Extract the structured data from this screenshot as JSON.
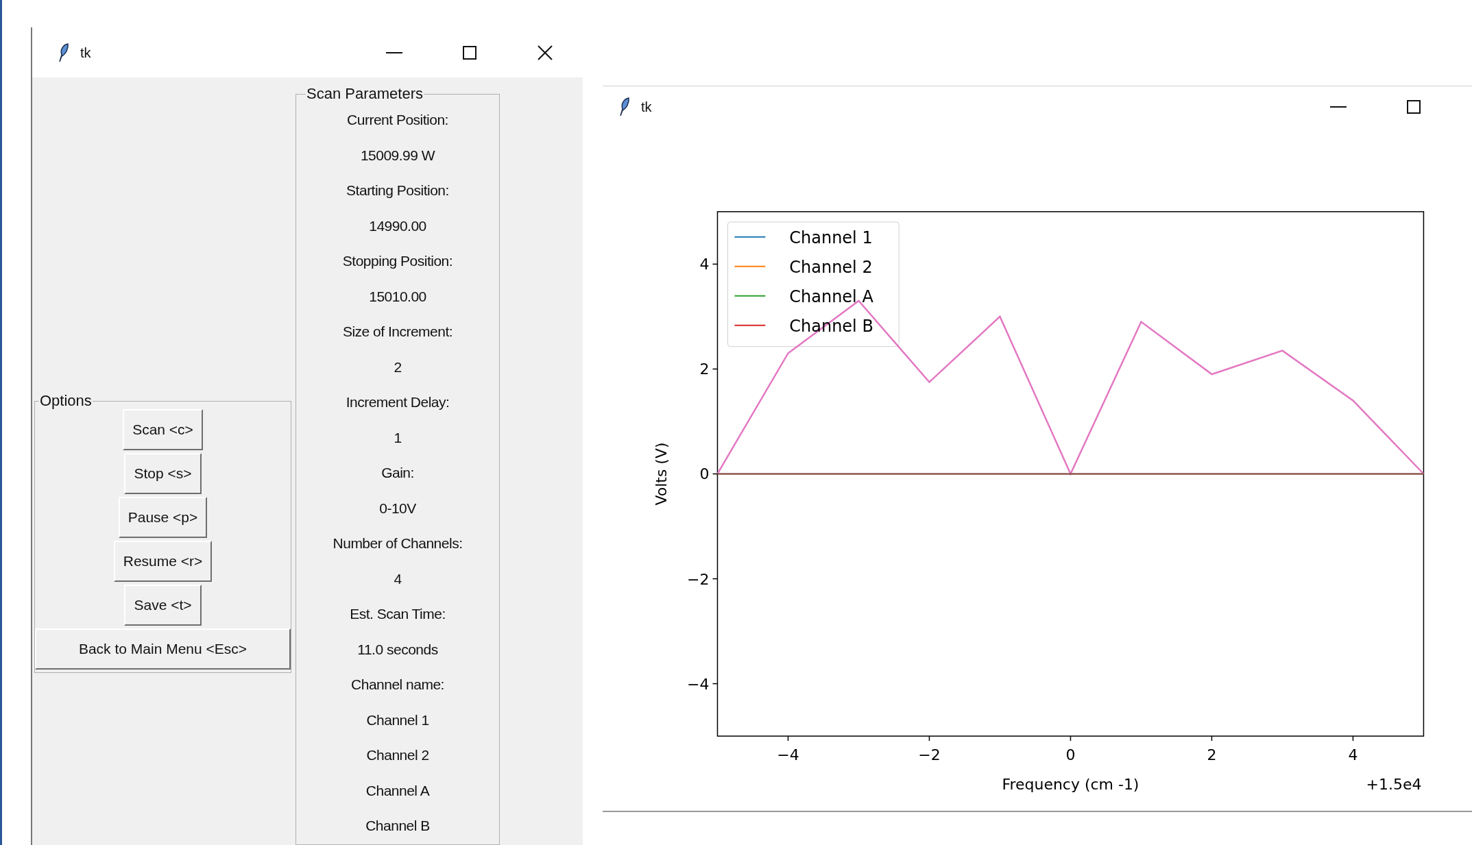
{
  "control_window": {
    "title": "tk",
    "options": {
      "title": "Options",
      "buttons": [
        {
          "label": "Scan <c>",
          "kind": "compact"
        },
        {
          "label": "Stop <s>",
          "kind": "compact"
        },
        {
          "label": "Pause <p>",
          "kind": "compact"
        },
        {
          "label": "Resume <r>",
          "kind": "compact"
        },
        {
          "label": "Save <t>",
          "kind": "compact"
        },
        {
          "label": "Back to Main Menu <Esc>",
          "kind": "wide"
        }
      ]
    },
    "scan_parameters": {
      "title": "Scan Parameters",
      "fields": [
        {
          "label": "Current Position:",
          "value": "15009.99 W"
        },
        {
          "label": "Starting Position:",
          "value": "14990.00"
        },
        {
          "label": "Stopping Position:",
          "value": "15010.00"
        },
        {
          "label": "Size of Increment:",
          "value": "2"
        },
        {
          "label": "Increment Delay:",
          "value": "1"
        },
        {
          "label": "Gain:",
          "value": "0-10V"
        },
        {
          "label": "Number of Channels:",
          "value": "4"
        },
        {
          "label": "Est. Scan Time:",
          "value": "11.0 seconds"
        }
      ],
      "channel_names": {
        "label": "Channel name:",
        "names": [
          "Channel 1",
          "Channel 2",
          "Channel A",
          "Channel B"
        ]
      }
    }
  },
  "plot_window": {
    "title": "tk",
    "chart_data": {
      "type": "line",
      "xlabel": "Frequency (cm -1)",
      "ylabel": "Volts (V)",
      "x": [
        -5,
        -4,
        -3,
        -2,
        -1,
        0,
        1,
        2,
        3,
        4,
        5
      ],
      "xlim": [
        -5,
        5
      ],
      "ylim": [
        -5,
        5
      ],
      "xticks": [
        {
          "value": -4,
          "label": "−4"
        },
        {
          "value": -2,
          "label": "−2"
        },
        {
          "value": 0,
          "label": "0"
        },
        {
          "value": 2,
          "label": "2"
        },
        {
          "value": 4,
          "label": "4"
        }
      ],
      "yticks": [
        {
          "value": -4,
          "label": "−4"
        },
        {
          "value": -2,
          "label": "−2"
        },
        {
          "value": 0,
          "label": "0"
        },
        {
          "value": 2,
          "label": "2"
        },
        {
          "value": 4,
          "label": "4"
        }
      ],
      "series": [
        {
          "color": "#e377c2",
          "values": [
            0,
            2.3,
            3.3,
            1.75,
            3.0,
            0,
            2.9,
            1.9,
            2.35,
            1.4,
            0
          ]
        },
        {
          "name": "Channel 1",
          "color": "#1f77b4",
          "values": [
            null,
            null,
            null,
            null,
            null,
            null,
            null,
            null,
            null,
            null,
            null
          ]
        },
        {
          "name": "Channel 2",
          "color": "#ff7f0e",
          "values": [
            null,
            null,
            null,
            null,
            null,
            null,
            null,
            null,
            null,
            null,
            null
          ]
        },
        {
          "name": "Channel A",
          "color": "#2ca02c",
          "values": [
            null,
            null,
            null,
            null,
            null,
            null,
            null,
            null,
            null,
            null,
            null
          ]
        },
        {
          "name": "Channel B",
          "color": "#d62728",
          "values": [
            null,
            null,
            null,
            null,
            null,
            null,
            null,
            null,
            null,
            null,
            null
          ]
        },
        {
          "color": "#8c564b",
          "values": [
            0,
            0,
            0,
            0,
            0,
            0,
            0,
            0,
            0,
            0,
            0
          ]
        }
      ],
      "legend": "upper left",
      "annotations": [
        "+1.5e4"
      ]
    }
  }
}
